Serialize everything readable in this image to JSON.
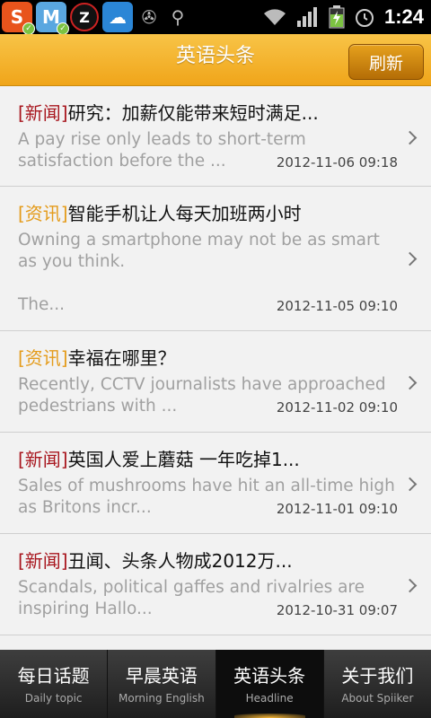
{
  "status_bar": {
    "icons": [
      "s-app-icon",
      "m-app-icon",
      "z-app-icon",
      "cloud-app-icon",
      "android-icon",
      "usb-icon",
      "wifi-icon",
      "signal-icon",
      "battery-icon",
      "alarm-icon"
    ],
    "time": "1:24"
  },
  "header": {
    "title": "英语头条",
    "refresh_label": "刷新"
  },
  "articles": [
    {
      "tag": "[新闻]",
      "tag_type": "news",
      "title": "研究：加薪仅能带来短时满足...",
      "summary": "A pay rise only leads to short-term satisfaction before the ...",
      "date": "2012-11-06 09:18"
    },
    {
      "tag": "[资讯]",
      "tag_type": "info",
      "title": "智能手机让人每天加班两小时",
      "summary": "Owning a smartphone may not be as smart as you think.\n\nThe...",
      "date": "2012-11-05 09:10"
    },
    {
      "tag": "[资讯]",
      "tag_type": "info",
      "title": "幸福在哪里？",
      "summary": "Recently, CCTV journalists have approached pedestrians with ...",
      "date": "2012-11-02 09:10"
    },
    {
      "tag": "[新闻]",
      "tag_type": "news",
      "title": "英国人爱上蘑菇 一年吃掉1...",
      "summary": "Sales of mushrooms have hit an all-time high as Britons incr...",
      "date": "2012-11-01 09:10"
    },
    {
      "tag": "[新闻]",
      "tag_type": "news",
      "title": "丑闻、头条人物成2012万...",
      "summary": "Scandals, political gaffes and rivalries are inspiring Hallo...",
      "date": "2012-10-31 09:07"
    }
  ],
  "tabs": [
    {
      "cn": "每日话题",
      "en": "Daily topic",
      "active": false
    },
    {
      "cn": "早晨英语",
      "en": "Morning English",
      "active": false
    },
    {
      "cn": "英语头条",
      "en": "Headline",
      "active": true
    },
    {
      "cn": "关于我们",
      "en": "About Spiiker",
      "active": false
    }
  ],
  "colors": {
    "header_accent": "#f0a51a",
    "tag_news": "#a8161e",
    "tag_info": "#e49b1a"
  }
}
